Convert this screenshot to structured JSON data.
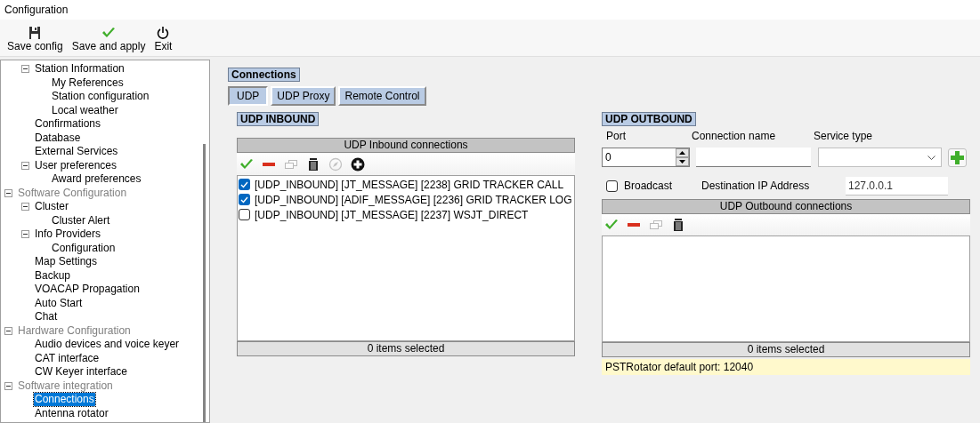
{
  "window": {
    "title": "Configuration"
  },
  "toolbar": [
    {
      "kind": "save",
      "label": "Save config"
    },
    {
      "kind": "apply",
      "label": "Save and apply"
    },
    {
      "kind": "exit",
      "label": "Exit"
    }
  ],
  "tree": [
    {
      "children": [
        {
          "label": "Station Information",
          "kind": "page",
          "selected": false,
          "expanded": true,
          "children": [
            {
              "label": "My References",
              "kind": "page",
              "selected": false
            },
            {
              "label": "Station configuration",
              "kind": "page",
              "selected": false
            },
            {
              "label": "Local weather",
              "kind": "page",
              "selected": false
            }
          ]
        },
        {
          "label": "Confirmations",
          "kind": "page",
          "selected": false
        },
        {
          "label": "Database",
          "kind": "page",
          "selected": false
        },
        {
          "label": "External Services",
          "kind": "page",
          "selected": false
        },
        {
          "label": "User preferences",
          "kind": "page",
          "selected": false,
          "expanded": true,
          "children": [
            {
              "label": "Award preferences",
              "kind": "page",
              "selected": false
            }
          ]
        }
      ]
    },
    {
      "label": "Software Configuration",
      "kind": "category",
      "selected": false,
      "expanded": true,
      "children": [
        {
          "label": "Cluster",
          "kind": "page",
          "selected": false,
          "expanded": true,
          "children": [
            {
              "label": "Cluster Alert",
              "kind": "page",
              "selected": false
            }
          ]
        },
        {
          "label": "Info Providers",
          "kind": "page",
          "selected": false,
          "expanded": true,
          "children": [
            {
              "label": "Configuration",
              "kind": "page",
              "selected": false
            }
          ]
        },
        {
          "label": "Map Settings",
          "kind": "page",
          "selected": false
        },
        {
          "label": "Backup",
          "kind": "page",
          "selected": false
        },
        {
          "label": "VOACAP Propagation",
          "kind": "page",
          "selected": false
        },
        {
          "label": "Auto Start",
          "kind": "page",
          "selected": false
        },
        {
          "label": "Chat",
          "kind": "page",
          "selected": false
        }
      ]
    },
    {
      "label": "Hardware Configuration",
      "kind": "category",
      "selected": false,
      "expanded": true,
      "children": [
        {
          "label": "Audio devices and voice keyer",
          "kind": "page",
          "selected": false
        },
        {
          "label": "CAT interface",
          "kind": "page",
          "selected": false
        },
        {
          "label": "CW Keyer interface",
          "kind": "page",
          "selected": false
        }
      ]
    },
    {
      "label": "Software integration",
      "kind": "category",
      "selected": false,
      "expanded": true,
      "children": [
        {
          "label": "Connections",
          "kind": "page",
          "selected": true
        },
        {
          "label": "Antenna rotator",
          "kind": "page",
          "selected": false
        }
      ]
    }
  ],
  "page_title": "Connections",
  "tabs": [
    {
      "label": "UDP",
      "selected": true
    },
    {
      "label": "UDP Proxy",
      "selected": false
    },
    {
      "label": "Remote Control",
      "selected": false
    }
  ],
  "inbound": {
    "title": "UDP INBOUND",
    "list_title": "UDP Inbound connections",
    "tools": [
      {
        "kind": "enable",
        "disabled": false
      },
      {
        "kind": "disable",
        "disabled": false
      },
      {
        "kind": "clone",
        "disabled": true
      },
      {
        "kind": "delete",
        "disabled": false
      },
      {
        "kind": "edit",
        "disabled": true
      },
      {
        "kind": "add",
        "disabled": false
      }
    ],
    "rows": [
      {
        "text": "[UDP_INBOUND] [JT_MESSAGE] [2238] GRID TRACKER CALL",
        "checked": true
      },
      {
        "text": "[UDP_INBOUND] [ADIF_MESSAGE] [2236] GRID TRACKER LOG",
        "checked": true
      },
      {
        "text": "[UDP_INBOUND] [JT_MESSAGE] [2237] WSJT_DIRECT",
        "checked": false
      }
    ],
    "footer": "0 items selected"
  },
  "outbound": {
    "title": "UDP OUTBOUND",
    "port_label": "Port",
    "port_value": "0",
    "name_label": "Connection name",
    "service_label": "Service type",
    "broadcast_label": "Broadcast",
    "broadcast_checked": false,
    "ip_label": "Destination IP Address",
    "ip_value": "127.0.0.1",
    "list_title": "UDP Outbound connections",
    "tools": [
      {
        "kind": "enable",
        "disabled": false
      },
      {
        "kind": "disable",
        "disabled": false
      },
      {
        "kind": "clone",
        "disabled": true
      },
      {
        "kind": "delete",
        "disabled": false
      }
    ],
    "footer": "0 items selected",
    "note": "PSTRotator default port: 12040"
  }
}
